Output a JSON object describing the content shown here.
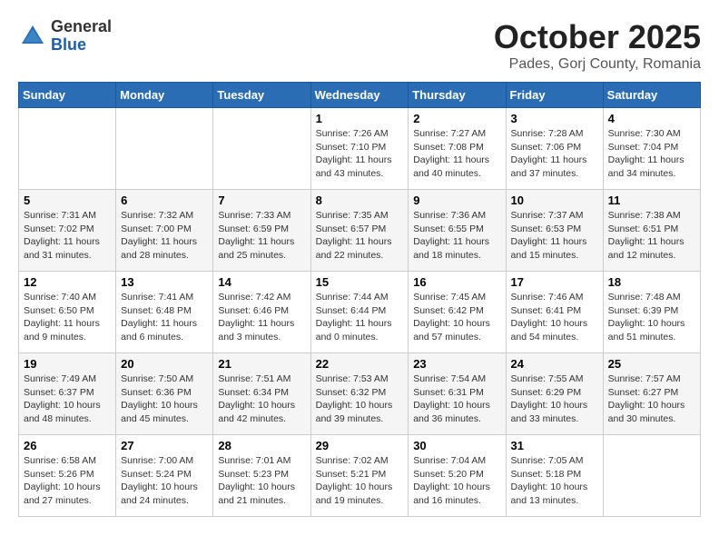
{
  "header": {
    "logo": {
      "general": "General",
      "blue": "Blue"
    },
    "title": "October 2025",
    "location": "Pades, Gorj County, Romania"
  },
  "weekdays": [
    "Sunday",
    "Monday",
    "Tuesday",
    "Wednesday",
    "Thursday",
    "Friday",
    "Saturday"
  ],
  "weeks": [
    [
      {
        "day": "",
        "info": ""
      },
      {
        "day": "",
        "info": ""
      },
      {
        "day": "",
        "info": ""
      },
      {
        "day": "1",
        "info": "Sunrise: 7:26 AM\nSunset: 7:10 PM\nDaylight: 11 hours and 43 minutes."
      },
      {
        "day": "2",
        "info": "Sunrise: 7:27 AM\nSunset: 7:08 PM\nDaylight: 11 hours and 40 minutes."
      },
      {
        "day": "3",
        "info": "Sunrise: 7:28 AM\nSunset: 7:06 PM\nDaylight: 11 hours and 37 minutes."
      },
      {
        "day": "4",
        "info": "Sunrise: 7:30 AM\nSunset: 7:04 PM\nDaylight: 11 hours and 34 minutes."
      }
    ],
    [
      {
        "day": "5",
        "info": "Sunrise: 7:31 AM\nSunset: 7:02 PM\nDaylight: 11 hours and 31 minutes."
      },
      {
        "day": "6",
        "info": "Sunrise: 7:32 AM\nSunset: 7:00 PM\nDaylight: 11 hours and 28 minutes."
      },
      {
        "day": "7",
        "info": "Sunrise: 7:33 AM\nSunset: 6:59 PM\nDaylight: 11 hours and 25 minutes."
      },
      {
        "day": "8",
        "info": "Sunrise: 7:35 AM\nSunset: 6:57 PM\nDaylight: 11 hours and 22 minutes."
      },
      {
        "day": "9",
        "info": "Sunrise: 7:36 AM\nSunset: 6:55 PM\nDaylight: 11 hours and 18 minutes."
      },
      {
        "day": "10",
        "info": "Sunrise: 7:37 AM\nSunset: 6:53 PM\nDaylight: 11 hours and 15 minutes."
      },
      {
        "day": "11",
        "info": "Sunrise: 7:38 AM\nSunset: 6:51 PM\nDaylight: 11 hours and 12 minutes."
      }
    ],
    [
      {
        "day": "12",
        "info": "Sunrise: 7:40 AM\nSunset: 6:50 PM\nDaylight: 11 hours and 9 minutes."
      },
      {
        "day": "13",
        "info": "Sunrise: 7:41 AM\nSunset: 6:48 PM\nDaylight: 11 hours and 6 minutes."
      },
      {
        "day": "14",
        "info": "Sunrise: 7:42 AM\nSunset: 6:46 PM\nDaylight: 11 hours and 3 minutes."
      },
      {
        "day": "15",
        "info": "Sunrise: 7:44 AM\nSunset: 6:44 PM\nDaylight: 11 hours and 0 minutes."
      },
      {
        "day": "16",
        "info": "Sunrise: 7:45 AM\nSunset: 6:42 PM\nDaylight: 10 hours and 57 minutes."
      },
      {
        "day": "17",
        "info": "Sunrise: 7:46 AM\nSunset: 6:41 PM\nDaylight: 10 hours and 54 minutes."
      },
      {
        "day": "18",
        "info": "Sunrise: 7:48 AM\nSunset: 6:39 PM\nDaylight: 10 hours and 51 minutes."
      }
    ],
    [
      {
        "day": "19",
        "info": "Sunrise: 7:49 AM\nSunset: 6:37 PM\nDaylight: 10 hours and 48 minutes."
      },
      {
        "day": "20",
        "info": "Sunrise: 7:50 AM\nSunset: 6:36 PM\nDaylight: 10 hours and 45 minutes."
      },
      {
        "day": "21",
        "info": "Sunrise: 7:51 AM\nSunset: 6:34 PM\nDaylight: 10 hours and 42 minutes."
      },
      {
        "day": "22",
        "info": "Sunrise: 7:53 AM\nSunset: 6:32 PM\nDaylight: 10 hours and 39 minutes."
      },
      {
        "day": "23",
        "info": "Sunrise: 7:54 AM\nSunset: 6:31 PM\nDaylight: 10 hours and 36 minutes."
      },
      {
        "day": "24",
        "info": "Sunrise: 7:55 AM\nSunset: 6:29 PM\nDaylight: 10 hours and 33 minutes."
      },
      {
        "day": "25",
        "info": "Sunrise: 7:57 AM\nSunset: 6:27 PM\nDaylight: 10 hours and 30 minutes."
      }
    ],
    [
      {
        "day": "26",
        "info": "Sunrise: 6:58 AM\nSunset: 5:26 PM\nDaylight: 10 hours and 27 minutes."
      },
      {
        "day": "27",
        "info": "Sunrise: 7:00 AM\nSunset: 5:24 PM\nDaylight: 10 hours and 24 minutes."
      },
      {
        "day": "28",
        "info": "Sunrise: 7:01 AM\nSunset: 5:23 PM\nDaylight: 10 hours and 21 minutes."
      },
      {
        "day": "29",
        "info": "Sunrise: 7:02 AM\nSunset: 5:21 PM\nDaylight: 10 hours and 19 minutes."
      },
      {
        "day": "30",
        "info": "Sunrise: 7:04 AM\nSunset: 5:20 PM\nDaylight: 10 hours and 16 minutes."
      },
      {
        "day": "31",
        "info": "Sunrise: 7:05 AM\nSunset: 5:18 PM\nDaylight: 10 hours and 13 minutes."
      },
      {
        "day": "",
        "info": ""
      }
    ]
  ]
}
